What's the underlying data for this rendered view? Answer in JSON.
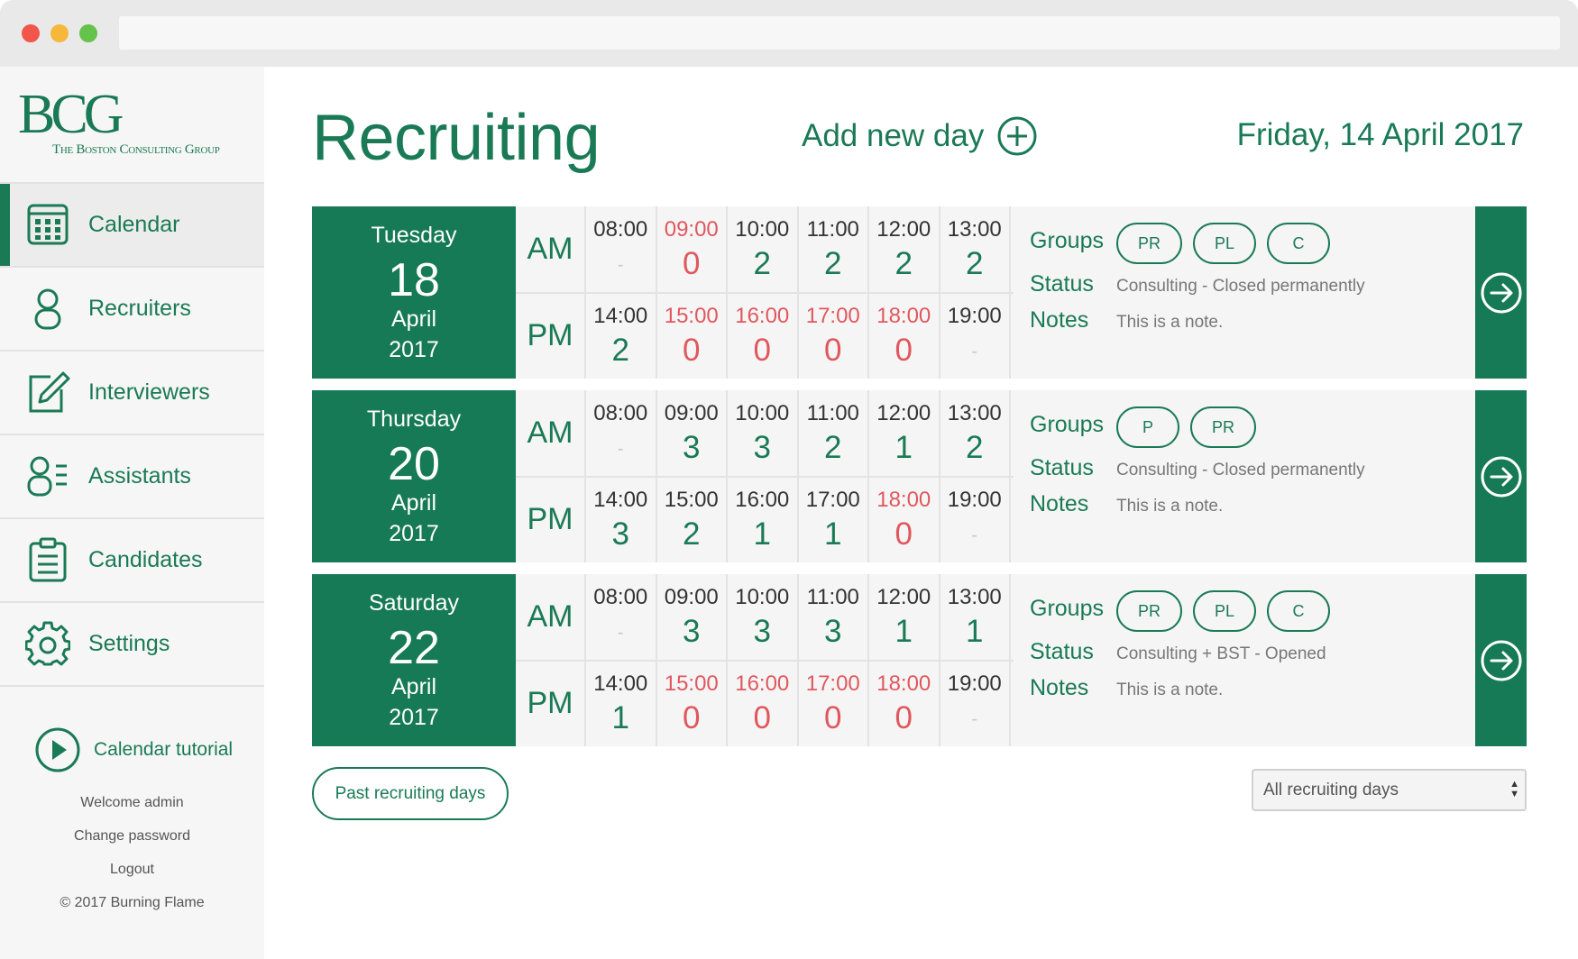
{
  "sidebar": {
    "logo": "BCG",
    "logo_sub": "The Boston Consulting Group",
    "items": [
      {
        "label": "Calendar",
        "icon": "calendar-icon"
      },
      {
        "label": "Recruiters",
        "icon": "person-icon"
      },
      {
        "label": "Interviewers",
        "icon": "edit-icon"
      },
      {
        "label": "Assistants",
        "icon": "person-list-icon"
      },
      {
        "label": "Candidates",
        "icon": "clipboard-icon"
      },
      {
        "label": "Settings",
        "icon": "gear-icon"
      }
    ],
    "tutorial": "Calendar tutorial",
    "welcome": "Welcome admin",
    "change_password": "Change password",
    "logout": "Logout",
    "copyright": "© 2017 Burning Flame"
  },
  "header": {
    "title": "Recruiting",
    "add_day": "Add new day",
    "date": "Friday, 14 April 2017"
  },
  "labels": {
    "am": "AM",
    "pm": "PM",
    "groups": "Groups",
    "status": "Status",
    "notes": "Notes"
  },
  "days": [
    {
      "weekday": "Tuesday",
      "day": "18",
      "month": "April",
      "year": "2017",
      "am": [
        {
          "time": "08:00",
          "count": "-",
          "red": false
        },
        {
          "time": "09:00",
          "count": "0",
          "red": true
        },
        {
          "time": "10:00",
          "count": "2",
          "red": false
        },
        {
          "time": "11:00",
          "count": "2",
          "red": false
        },
        {
          "time": "12:00",
          "count": "2",
          "red": false
        },
        {
          "time": "13:00",
          "count": "2",
          "red": false
        }
      ],
      "pm": [
        {
          "time": "14:00",
          "count": "2",
          "red": false
        },
        {
          "time": "15:00",
          "count": "0",
          "red": true
        },
        {
          "time": "16:00",
          "count": "0",
          "red": true
        },
        {
          "time": "17:00",
          "count": "0",
          "red": true
        },
        {
          "time": "18:00",
          "count": "0",
          "red": true
        },
        {
          "time": "19:00",
          "count": "-",
          "red": false
        }
      ],
      "groups": [
        "PR",
        "PL",
        "C"
      ],
      "status": "Consulting - Closed permanently",
      "notes": "This is a note."
    },
    {
      "weekday": "Thursday",
      "day": "20",
      "month": "April",
      "year": "2017",
      "am": [
        {
          "time": "08:00",
          "count": "-",
          "red": false
        },
        {
          "time": "09:00",
          "count": "3",
          "red": false
        },
        {
          "time": "10:00",
          "count": "3",
          "red": false
        },
        {
          "time": "11:00",
          "count": "2",
          "red": false
        },
        {
          "time": "12:00",
          "count": "1",
          "red": false
        },
        {
          "time": "13:00",
          "count": "2",
          "red": false
        }
      ],
      "pm": [
        {
          "time": "14:00",
          "count": "3",
          "red": false
        },
        {
          "time": "15:00",
          "count": "2",
          "red": false
        },
        {
          "time": "16:00",
          "count": "1",
          "red": false
        },
        {
          "time": "17:00",
          "count": "1",
          "red": false
        },
        {
          "time": "18:00",
          "count": "0",
          "red": true
        },
        {
          "time": "19:00",
          "count": "-",
          "red": false
        }
      ],
      "groups": [
        "P",
        "PR"
      ],
      "status": "Consulting - Closed permanently",
      "notes": "This is a note."
    },
    {
      "weekday": "Saturday",
      "day": "22",
      "month": "April",
      "year": "2017",
      "am": [
        {
          "time": "08:00",
          "count": "-",
          "red": false
        },
        {
          "time": "09:00",
          "count": "3",
          "red": false
        },
        {
          "time": "10:00",
          "count": "3",
          "red": false
        },
        {
          "time": "11:00",
          "count": "3",
          "red": false
        },
        {
          "time": "12:00",
          "count": "1",
          "red": false
        },
        {
          "time": "13:00",
          "count": "1",
          "red": false
        }
      ],
      "pm": [
        {
          "time": "14:00",
          "count": "1",
          "red": false
        },
        {
          "time": "15:00",
          "count": "0",
          "red": true
        },
        {
          "time": "16:00",
          "count": "0",
          "red": true
        },
        {
          "time": "17:00",
          "count": "0",
          "red": true
        },
        {
          "time": "18:00",
          "count": "0",
          "red": true
        },
        {
          "time": "19:00",
          "count": "-",
          "red": false
        }
      ],
      "groups": [
        "PR",
        "PL",
        "C"
      ],
      "status": "Consulting + BST - Opened",
      "notes": "This is a note."
    }
  ],
  "footer": {
    "past_button": "Past recruiting days",
    "filter_selected": "All recruiting days"
  },
  "colors": {
    "brand": "#1a7a55",
    "alert": "#e0585e",
    "muted": "#777777"
  }
}
